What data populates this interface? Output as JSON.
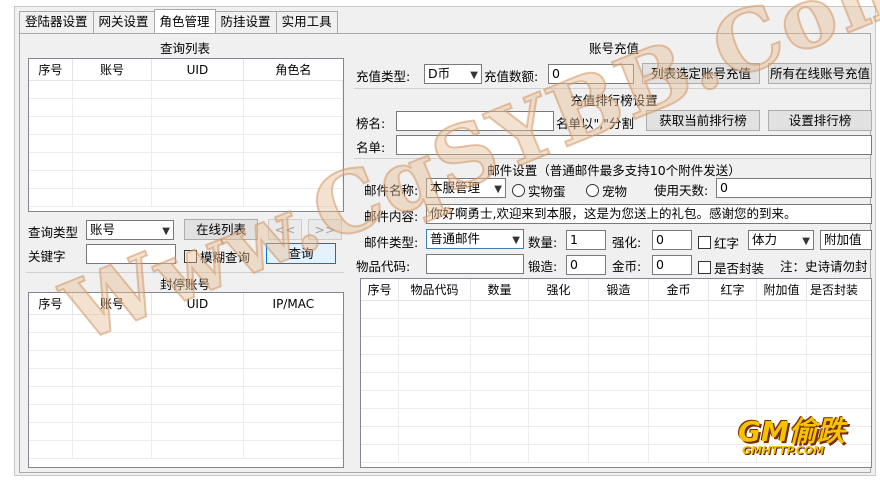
{
  "tabs": [
    "登陆器设置",
    "网关设置",
    "角色管理",
    "防挂设置",
    "实用工具"
  ],
  "query_list": {
    "title": "查询列表",
    "columns": [
      "序号",
      "账号",
      "UID",
      "角色名"
    ]
  },
  "query_form": {
    "type_label": "查询类型",
    "type_value": "账号",
    "online_list_button": "在线列表",
    "prev_button": "<<",
    "next_button": ">>",
    "keyword_label": "关键字",
    "keyword_value": "",
    "fuzzy_label": "模糊查询",
    "query_button": "查询"
  },
  "banned": {
    "title": "封停账号",
    "columns": [
      "序号",
      "账号",
      "UID",
      "IP/MAC"
    ]
  },
  "recharge": {
    "title": "账号充值",
    "type_label": "充值类型:",
    "type_value": "D币",
    "amount_label": "充值数额:",
    "amount_value": "0",
    "selected_button": "列表选定账号充值",
    "all_online_button": "所有在线账号充值"
  },
  "ranking": {
    "title": "充值排行榜设置",
    "list_name_label": "榜名:",
    "list_name_value": "",
    "separator_hint": "名单以\",\"分割",
    "get_button": "获取当前排行榜",
    "set_button": "设置排行榜",
    "names_label": "名单:",
    "names_value": ""
  },
  "mail": {
    "title": "邮件设置（普通邮件最多支持10个附件发送）",
    "name_label": "邮件名称:",
    "name_value": "本服管理",
    "real_item_label": "实物蛋",
    "virtual_item_label": "宠物",
    "days_label": "使用天数:",
    "days_value": "0",
    "content_label": "邮件内容:",
    "content_value": "你好啊勇士,欢迎来到本服，这是为您送上的礼包。感谢您的到来。",
    "type_label": "邮件类型:",
    "type_value": "普通邮件",
    "qty_label": "数量:",
    "qty_value": "1",
    "enhance_label": "强化:",
    "enhance_value": "0",
    "red_label": "红字",
    "attr_value": "体力",
    "addval_value": "附加值",
    "code_label": "物品代码:",
    "code_value": "",
    "forge_label": "锻造:",
    "forge_value": "0",
    "gold_label": "金币:",
    "gold_value": "0",
    "sealed_label": "是否封装",
    "note": "注：史诗请勿封",
    "columns": [
      "序号",
      "物品代码",
      "数量",
      "强化",
      "锻造",
      "金币",
      "红字",
      "附加值",
      "是否封装"
    ]
  },
  "watermark": "Www.CqSYBB.Com",
  "logo": {
    "main": "GM偷跌",
    "sub": "GMHTTP.COM"
  }
}
